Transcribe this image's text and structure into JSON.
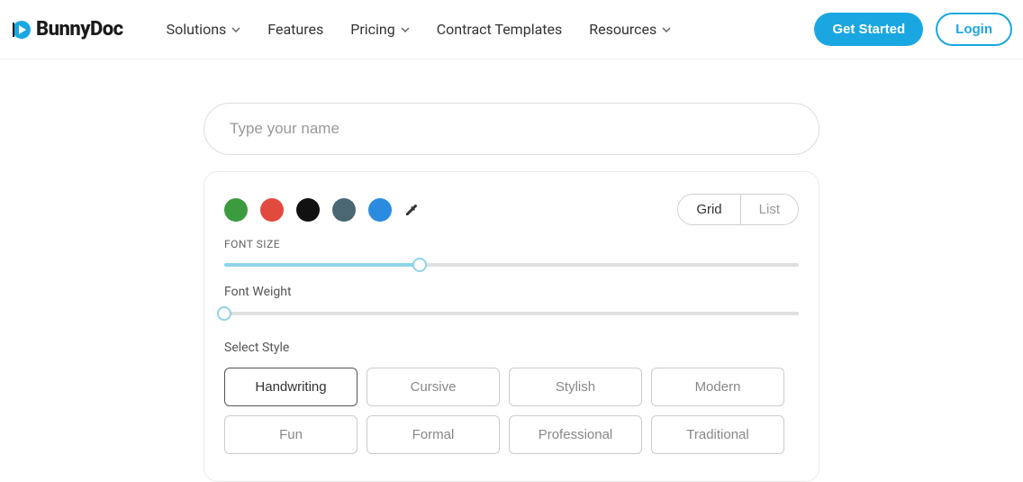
{
  "nav": {
    "brand": "BunnyDoc",
    "items": [
      {
        "label": "Solutions",
        "hasDropdown": true
      },
      {
        "label": "Features",
        "hasDropdown": false
      },
      {
        "label": "Pricing",
        "hasDropdown": true
      },
      {
        "label": "Contract Templates",
        "hasDropdown": false
      },
      {
        "label": "Resources",
        "hasDropdown": true
      }
    ],
    "getStarted": "Get Started",
    "login": "Login"
  },
  "input": {
    "placeholder": "Type your name",
    "value": ""
  },
  "colors": [
    "#3a9b3f",
    "#e24a3f",
    "#111111",
    "#4a6773",
    "#2b8be0"
  ],
  "viewToggle": {
    "grid": "Grid",
    "list": "List"
  },
  "fontSizeLabel": "FONT SIZE",
  "fontWeightLabel": "Font Weight",
  "selectStyleLabel": "Select Style",
  "slider": {
    "fontSizePercent": 34,
    "fontWeightPercent": 0
  },
  "styles": [
    "Handwriting",
    "Cursive",
    "Stylish",
    "Modern",
    "Fun",
    "Formal",
    "Professional",
    "Traditional"
  ],
  "activeStyle": "Handwriting"
}
